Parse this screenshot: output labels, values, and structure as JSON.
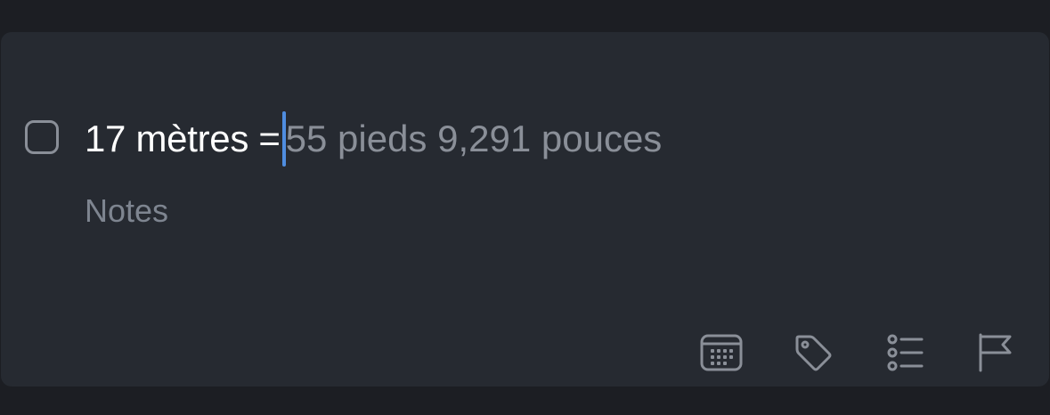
{
  "task": {
    "title_input": "17 mètres =",
    "conversion_suggestion": "55 pieds 9,291 pouces",
    "notes_placeholder": "Notes",
    "completed": false
  },
  "toolbar": {
    "icons": [
      "calendar-icon",
      "tag-icon",
      "checklist-icon",
      "flag-icon"
    ]
  },
  "colors": {
    "background": "#1c1e23",
    "card": "#262a31",
    "text": "#ffffff",
    "muted": "#8a8f98",
    "caret": "#4f8de0"
  }
}
